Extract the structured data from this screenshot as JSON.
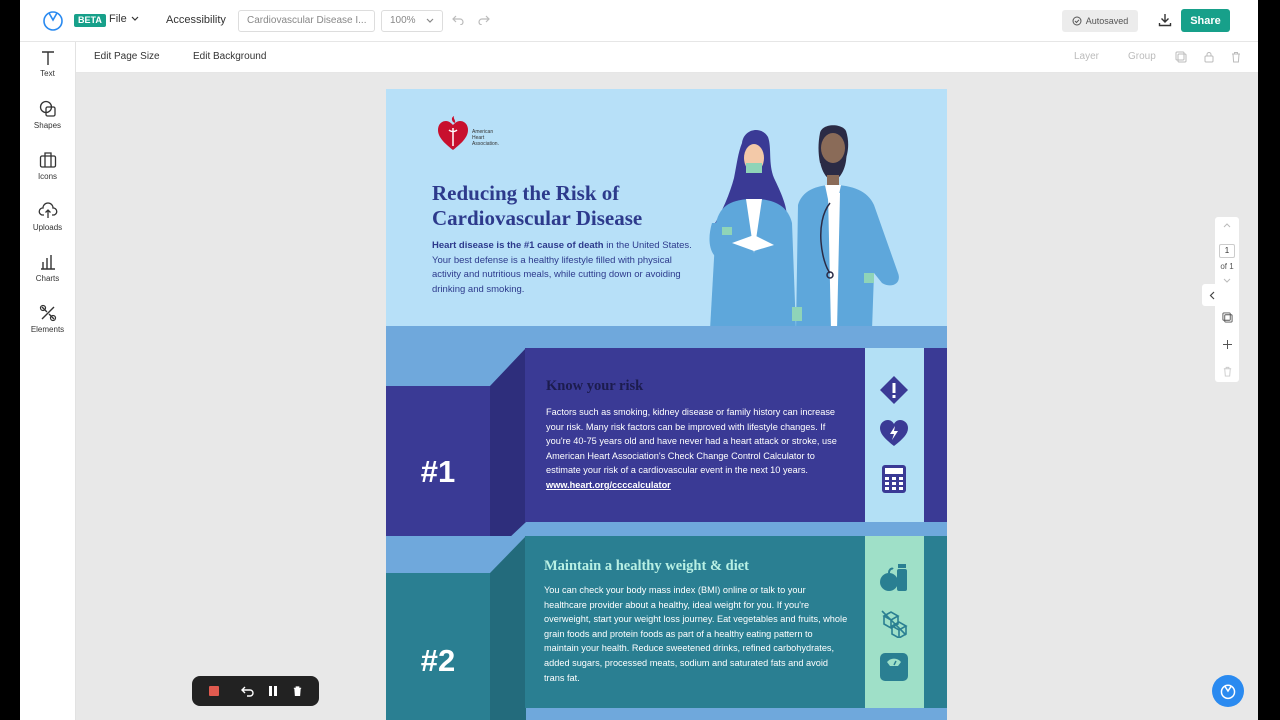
{
  "app": {
    "beta_label": "BETA",
    "file_menu": "File",
    "accessibility": "Accessibility",
    "document_title": "Cardiovascular Disease I...",
    "zoom": "100%",
    "autosave": "Autosaved",
    "share": "Share",
    "colors": {
      "accent": "#17a08a",
      "help": "#2a8af0",
      "record": "#e05a4f"
    }
  },
  "subbar": {
    "edit_page_size": "Edit Page Size",
    "edit_background": "Edit Background",
    "layer": "Layer",
    "group": "Group"
  },
  "sidebar": {
    "items": [
      {
        "label": "Text",
        "icon": "text-icon"
      },
      {
        "label": "Shapes",
        "icon": "shapes-icon"
      },
      {
        "label": "Icons",
        "icon": "icons-icon"
      },
      {
        "label": "Uploads",
        "icon": "upload-icon"
      },
      {
        "label": "Charts",
        "icon": "chart-icon"
      },
      {
        "label": "Elements",
        "icon": "elements-icon"
      }
    ]
  },
  "pager": {
    "current": "1",
    "of": "of 1"
  },
  "infographic": {
    "org_name": "American Heart Association.",
    "headline": "Reducing the Risk of Cardiovascular Disease",
    "intro_bold": "Heart disease is the #1 cause of death",
    "intro_rest": " in the United States. Your best defense is a healthy lifestyle filled with physical activity and nutritious meals, while cutting down or avoiding drinking and smoking.",
    "sections": [
      {
        "number": "#1",
        "title": "Know your risk",
        "body": "Factors such as smoking, kidney disease or family history can increase your risk. Many risk factors can be improved with lifestyle changes. If you're 40-75 years old and have never had a heart attack or stroke, use American Heart Association's Check Change Control Calculator to estimate your risk of a cardiovascular event in the next 10 years. ",
        "link": "www.heart.org/ccccalculator",
        "colors": {
          "main": "#3a3a95",
          "dark": "#2e2e7c",
          "title": "#1c1c4e",
          "icon_strip": "#b3e0f5",
          "icon": "#3a3a95"
        }
      },
      {
        "number": "#2",
        "title": "Maintain a healthy weight & diet",
        "body": "You can check your body mass index (BMI) online or talk to your healthcare provider about a healthy, ideal weight for you. If you're overweight, start your weight loss journey. Eat vegetables and fruits, whole grain foods and protein foods as part of a healthy eating pattern to maintain your health. Reduce sweetened drinks, refined carbohydrates, added sugars, processed meats, sodium and saturated fats and avoid trans fat.",
        "colors": {
          "main": "#2a7f92",
          "dark": "#236b7c",
          "title": "#b8f0e4",
          "icon_strip": "#9fe0c8",
          "icon": "#2a7f92"
        }
      }
    ]
  }
}
